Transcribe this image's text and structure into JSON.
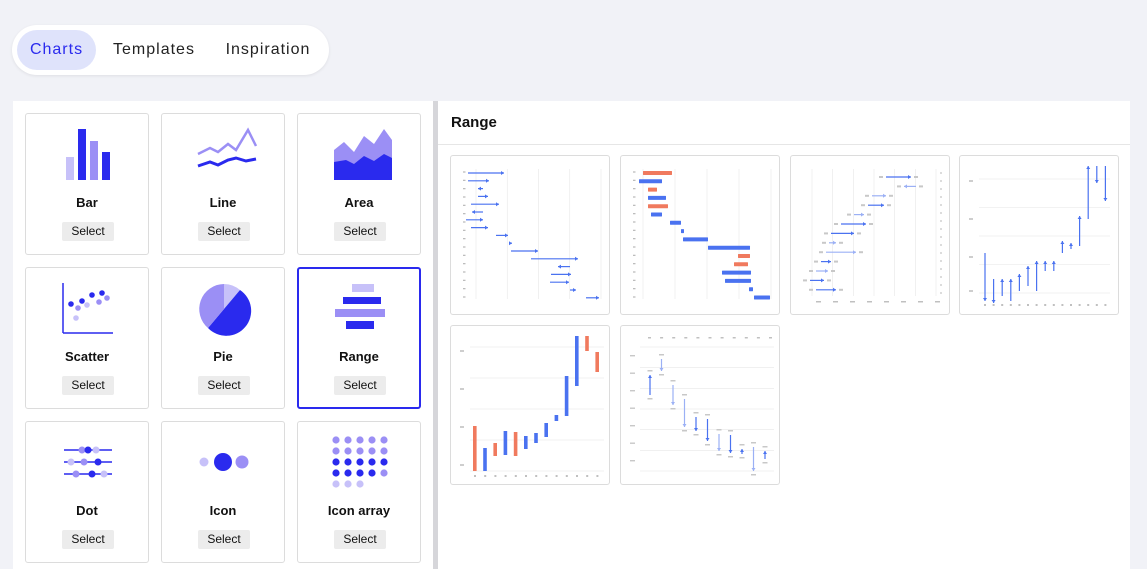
{
  "tabs": [
    {
      "label": "Charts",
      "active": true
    },
    {
      "label": "Templates",
      "active": false
    },
    {
      "label": "Inspiration",
      "active": false
    }
  ],
  "chart_types": [
    {
      "label": "Bar",
      "button": "Select",
      "icon": "bar-chart-icon"
    },
    {
      "label": "Line",
      "button": "Select",
      "icon": "line-chart-icon"
    },
    {
      "label": "Area",
      "button": "Select",
      "icon": "area-chart-icon"
    },
    {
      "label": "Scatter",
      "button": "Select",
      "icon": "scatter-chart-icon"
    },
    {
      "label": "Pie",
      "button": "Select",
      "icon": "pie-chart-icon"
    },
    {
      "label": "Range",
      "button": "Select",
      "icon": "range-chart-icon",
      "selected": true
    },
    {
      "label": "Dot",
      "button": "Select",
      "icon": "dot-chart-icon"
    },
    {
      "label": "Icon",
      "button": "Select",
      "icon": "icon-chart-icon"
    },
    {
      "label": "Icon array",
      "button": "Select",
      "icon": "icon-array-chart-icon"
    }
  ],
  "preview": {
    "title": "Range",
    "thumbnails": [
      {
        "name": "range-arrows-horizontal"
      },
      {
        "name": "range-bars-horizontal"
      },
      {
        "name": "range-arrows-labeled"
      },
      {
        "name": "range-arrows-vertical"
      },
      {
        "name": "range-bars-vertical"
      },
      {
        "name": "range-arrows-vertical-labeled"
      }
    ]
  },
  "colors": {
    "accent": "#2a2aee",
    "accent_light": "#9b8ff5",
    "accent_pale": "#c7c1f9",
    "tab_active_bg": "#dfe3fb",
    "range_blue": "#4a72f0",
    "range_red": "#f07a5e"
  }
}
